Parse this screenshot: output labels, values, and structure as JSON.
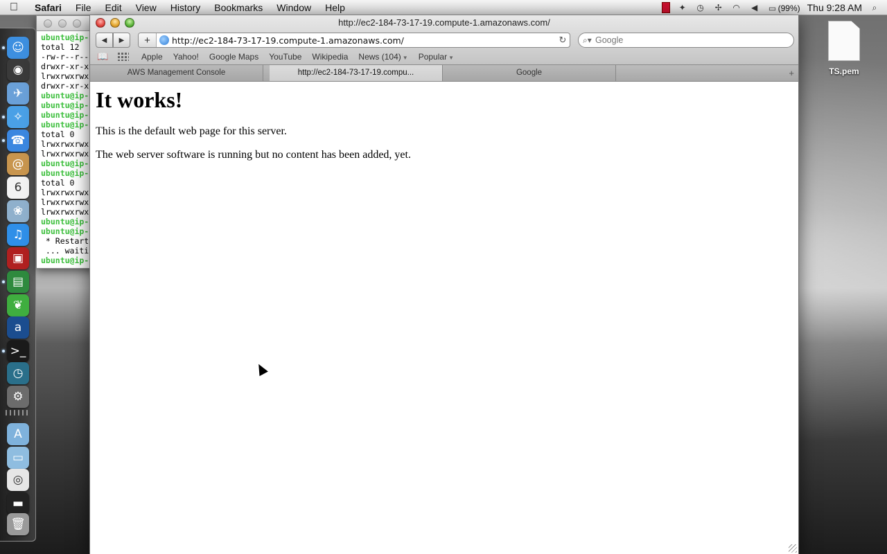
{
  "menubar": {
    "app_name": "Safari",
    "menus": [
      "File",
      "Edit",
      "View",
      "History",
      "Bookmarks",
      "Window",
      "Help"
    ],
    "battery": "(99%)",
    "clock": "Thu 9:28 AM"
  },
  "terminal": {
    "lines": [
      {
        "text": "ubuntu@ip-",
        "prompt": true
      },
      {
        "text": "total 12",
        "prompt": false
      },
      {
        "text": "-rw-r--r--",
        "prompt": false
      },
      {
        "text": "drwxr-xr-x",
        "prompt": false
      },
      {
        "text": "lrwxrwxrwx",
        "prompt": false
      },
      {
        "text": "drwxr-xr-x",
        "prompt": false
      },
      {
        "text": "ubuntu@ip-",
        "prompt": true
      },
      {
        "text": "ubuntu@ip-",
        "prompt": true
      },
      {
        "text": "ubuntu@ip-",
        "prompt": true
      },
      {
        "text": "ubuntu@ip-",
        "prompt": true
      },
      {
        "text": "total 0",
        "prompt": false
      },
      {
        "text": "lrwxrwxrwx",
        "prompt": false
      },
      {
        "text": "lrwxrwxrwx",
        "prompt": false
      },
      {
        "text": "ubuntu@ip-",
        "prompt": true
      },
      {
        "text": "ubuntu@ip-",
        "prompt": true
      },
      {
        "text": "total 0",
        "prompt": false
      },
      {
        "text": "lrwxrwxrwx",
        "prompt": false
      },
      {
        "text": "lrwxrwxrwx",
        "prompt": false
      },
      {
        "text": "lrwxrwxrwx",
        "prompt": false
      },
      {
        "text": "ubuntu@ip-",
        "prompt": true
      },
      {
        "text": "ubuntu@ip-",
        "prompt": true
      },
      {
        "text": " * Restart",
        "prompt": false
      },
      {
        "text": " ... waiti",
        "prompt": false
      },
      {
        "text": "ubuntu@ip-",
        "prompt": true
      }
    ]
  },
  "safari": {
    "window_title": "http://ec2-184-73-17-19.compute-1.amazonaws.com/",
    "address": "http://ec2-184-73-17-19.compute-1.amazonaws.com/",
    "search_placeholder": "Google",
    "bookmarks": [
      {
        "label": "Apple",
        "has_menu": false
      },
      {
        "label": "Yahoo!",
        "has_menu": false
      },
      {
        "label": "Google Maps",
        "has_menu": false
      },
      {
        "label": "YouTube",
        "has_menu": false
      },
      {
        "label": "Wikipedia",
        "has_menu": false
      },
      {
        "label": "News (104)",
        "has_menu": true
      },
      {
        "label": "Popular",
        "has_menu": true
      }
    ],
    "tabs": [
      {
        "label": "AWS Management Console",
        "active": false
      },
      {
        "label": "http://ec2-184-73-17-19.compu...",
        "active": true
      },
      {
        "label": "Google",
        "active": false
      }
    ],
    "page": {
      "heading": "It works!",
      "paragraphs": [
        "This is the default web page for this server.",
        "The web server software is running but no content has been added, yet."
      ]
    }
  },
  "desktop": {
    "file_name": "TS.pem"
  },
  "dock": {
    "icons": [
      {
        "name": "finder-icon",
        "glyph": "☺",
        "color": "#3d8fe0",
        "running": true
      },
      {
        "name": "dashboard-icon",
        "glyph": "◉",
        "color": "#3a3a3a",
        "running": false
      },
      {
        "name": "mail-icon",
        "glyph": "✈",
        "color": "#6aa0d8",
        "running": false
      },
      {
        "name": "safari-icon",
        "glyph": "✧",
        "color": "#4aa0e6",
        "running": true
      },
      {
        "name": "ichat-icon",
        "glyph": "☎",
        "color": "#3b87e0",
        "running": true
      },
      {
        "name": "address-book-icon",
        "glyph": "@",
        "color": "#c8954e",
        "running": false
      },
      {
        "name": "ical-icon",
        "glyph": "6",
        "color": "#f2f2f2",
        "running": false
      },
      {
        "name": "iphoto-icon",
        "glyph": "❀",
        "color": "#8fb0cc",
        "running": false
      },
      {
        "name": "itunes-icon",
        "glyph": "♫",
        "color": "#2f8fe8",
        "running": false
      },
      {
        "name": "photo-booth-icon",
        "glyph": "▣",
        "color": "#b02020",
        "running": false
      },
      {
        "name": "numbers-icon",
        "glyph": "▤",
        "color": "#2e8a3e",
        "running": true
      },
      {
        "name": "leaf-icon",
        "glyph": "❦",
        "color": "#3fae3f",
        "running": false
      },
      {
        "name": "amazon-icon",
        "glyph": "a",
        "color": "#1b4d8f",
        "running": false
      },
      {
        "name": "terminal-icon",
        "glyph": ">_",
        "color": "#1a1a1a",
        "running": true
      },
      {
        "name": "time-machine-icon",
        "glyph": "◷",
        "color": "#2a6f8a",
        "running": false
      },
      {
        "name": "system-preferences-icon",
        "glyph": "⚙",
        "color": "#6c6c6c",
        "running": false
      },
      {
        "name": "applications-folder-icon",
        "glyph": "A",
        "color": "#7fb2dc",
        "running": false
      },
      {
        "name": "documents-folder-icon",
        "glyph": "▭",
        "color": "#8fbde0",
        "running": false
      },
      {
        "name": "document-icon",
        "glyph": "◎",
        "color": "#e6e6e6",
        "running": false
      },
      {
        "name": "display-icon",
        "glyph": "▬",
        "color": "#222222",
        "running": false
      },
      {
        "name": "trash-icon",
        "glyph": "🗑",
        "color": "#9a9a9a",
        "running": false
      }
    ]
  }
}
